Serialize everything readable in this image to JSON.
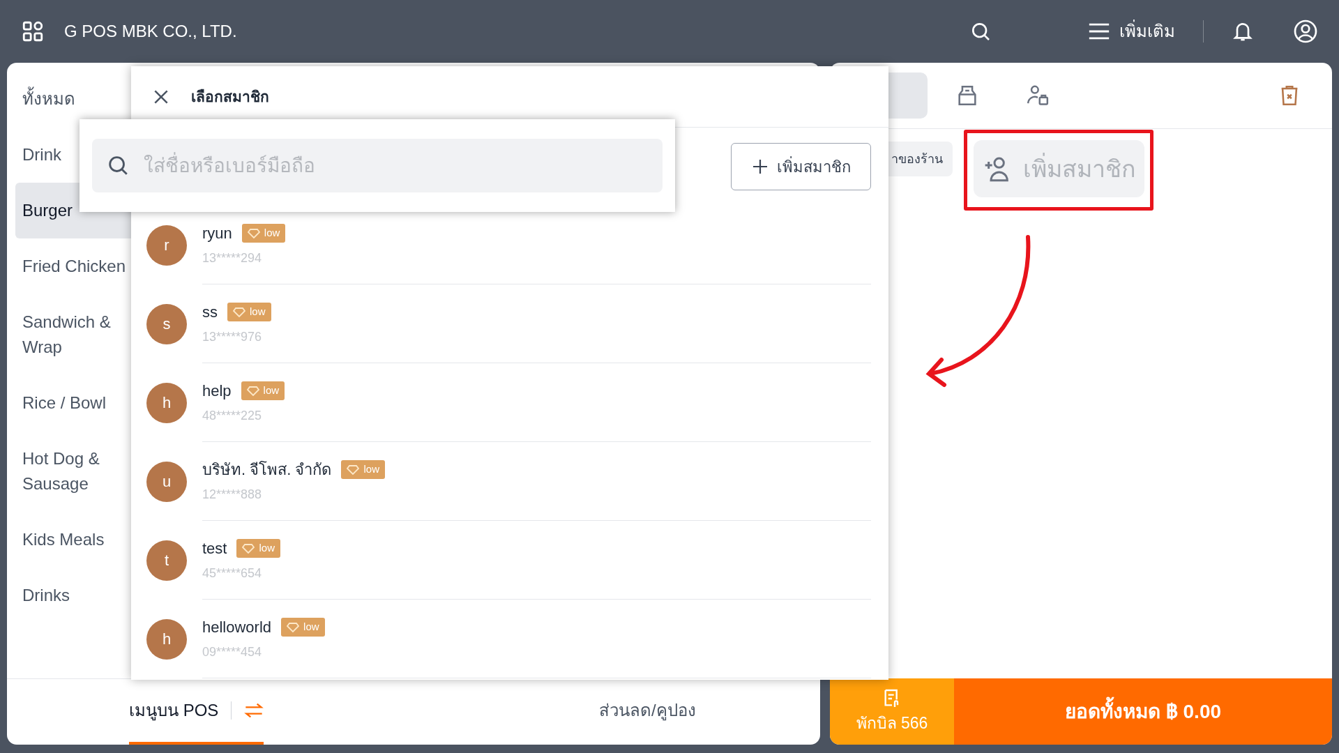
{
  "app_bar": {
    "title": "G POS MBK CO., LTD.",
    "more_label": "เพิ่มเติม"
  },
  "categories": [
    {
      "label": "ทั้งหมด",
      "selected": false
    },
    {
      "label": "Drink",
      "selected": false
    },
    {
      "label": "Burger",
      "selected": true
    },
    {
      "label": "Fried Chicken",
      "selected": false
    },
    {
      "label": "Sandwich & Wrap",
      "selected": false
    },
    {
      "label": "Rice / Bowl",
      "selected": false
    },
    {
      "label": "Hot Dog & Sausage",
      "selected": false
    },
    {
      "label": "Kids Meals",
      "selected": false
    },
    {
      "label": "Drinks",
      "selected": false
    }
  ],
  "bottom_tabs": [
    {
      "label": "เมนูบน POS",
      "selected": true,
      "kind": "switch"
    },
    {
      "label": "ส่วนลด/คูปอง",
      "selected": false,
      "kind": "plain"
    }
  ],
  "order_panel": {
    "chip": "าของร้าน",
    "add_member": "เพิ่มสมาชิก",
    "held_bills": "พักบิล 566",
    "total": "ยอดทั้งหมด ฿ 0.00"
  },
  "member_dialog": {
    "title": "เลือกสมาชิก",
    "search": {
      "placeholder": "ใส่ชื่อหรือเบอร์มือถือ"
    },
    "add_button": "เพิ่มสมาชิก",
    "members": [
      {
        "initial": "r",
        "name": "ryun",
        "tier": "low",
        "phone": "13*****294"
      },
      {
        "initial": "s",
        "name": "ss",
        "tier": "low",
        "phone": "13*****976"
      },
      {
        "initial": "h",
        "name": "help",
        "tier": "low",
        "phone": "48*****225"
      },
      {
        "initial": "u",
        "name": "บริษัท. จีโพส. จำกัด",
        "tier": "low",
        "phone": "12*****888"
      },
      {
        "initial": "t",
        "name": "test",
        "tier": "low",
        "phone": "45*****654"
      },
      {
        "initial": "h",
        "name": "helloworld",
        "tier": "low",
        "phone": "09*****454"
      }
    ]
  }
}
